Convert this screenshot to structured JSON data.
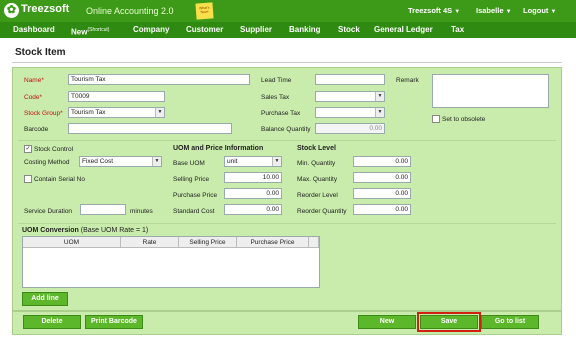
{
  "header": {
    "brand": "Treezsoft",
    "app_title": "Online Accounting 2.0",
    "whats_new": "What's New!",
    "company": "Treezsoft 4S",
    "user": "Isabelle",
    "logout": "Logout"
  },
  "nav": {
    "dashboard": "Dashboard",
    "new": "New",
    "new_sup": "(Shortcut)",
    "company": "Company",
    "customer": "Customer",
    "supplier": "Supplier",
    "banking": "Banking",
    "stock": "Stock",
    "general_ledger": "General Ledger",
    "tax": "Tax"
  },
  "page": {
    "title": "Stock Item"
  },
  "form": {
    "name_label": "Name*",
    "name_value": "Tourism Tax",
    "code_label": "Code*",
    "code_value": "T0009",
    "stock_group_label": "Stock Group*",
    "stock_group_value": "Tourism Tax",
    "barcode_label": "Barcode",
    "barcode_value": "",
    "lead_time_label": "Lead Time",
    "lead_time_value": "",
    "sales_tax_label": "Sales Tax",
    "sales_tax_value": "",
    "purchase_tax_label": "Purchase Tax",
    "purchase_tax_value": "",
    "balance_qty_label": "Balance Quantity",
    "balance_qty_value": "0.00",
    "remark_label": "Remark",
    "remark_value": "",
    "obsolete_label": "Set to obsolete",
    "stock_control_label": "Stock Control",
    "stock_control_checked": true,
    "costing_method_label": "Costing Method",
    "costing_method_value": "Fixed Cost",
    "serial_no_label": "Contain Serial No",
    "service_duration_label": "Service Duration",
    "service_duration_value": "",
    "service_duration_unit": "minutes"
  },
  "uom_price": {
    "heading": "UOM and Price Information",
    "base_uom_label": "Base UOM",
    "base_uom_value": "unit",
    "selling_price_label": "Selling Price",
    "selling_price_value": "10.00",
    "purchase_price_label": "Purchase Price",
    "purchase_price_value": "0.00",
    "standard_cost_label": "Standard Cost",
    "standard_cost_value": "0.00"
  },
  "stock_level": {
    "heading": "Stock Level",
    "min_qty_label": "Min. Quantity",
    "min_qty_value": "0.00",
    "max_qty_label": "Max. Quantity",
    "max_qty_value": "0.00",
    "reorder_level_label": "Reorder Level",
    "reorder_level_value": "0.00",
    "reorder_qty_label": "Reorder Quantity",
    "reorder_qty_value": "0.00"
  },
  "uom_conversion": {
    "heading": "UOM Conversion",
    "note": "(Base UOM Rate = 1)",
    "columns": [
      "UOM",
      "Rate",
      "Selling Price",
      "Purchase Price"
    ],
    "add_line": "Add line"
  },
  "footer": {
    "delete": "Delete",
    "print_barcode": "Print Barcode",
    "new": "New",
    "save": "Save",
    "go_to_list": "Go to list"
  },
  "colors": {
    "header_green": "#3d9a18",
    "panel_green": "#c9ecac",
    "button_green": "#5cb82a",
    "required_red": "#c01010",
    "save_highlight": "#d02010"
  }
}
